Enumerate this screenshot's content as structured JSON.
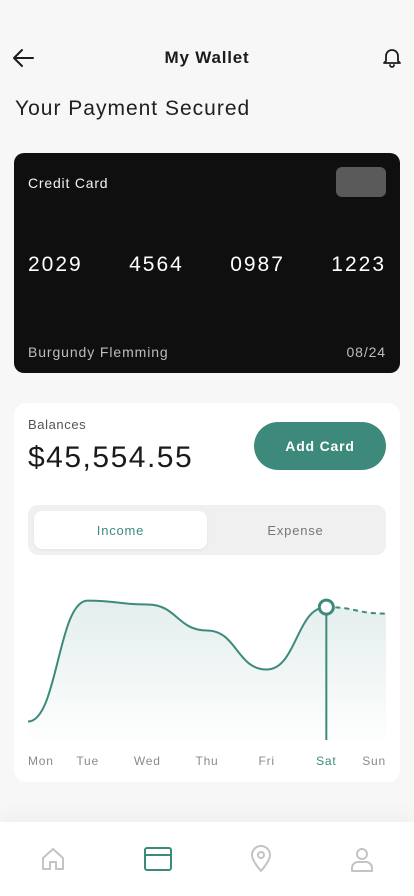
{
  "header": {
    "title": "My Wallet",
    "back_icon": "arrow-left-icon",
    "notification_icon": "bell-icon"
  },
  "page_title": "Your Payment Secured",
  "card": {
    "label": "Credit Card",
    "number_groups": [
      "2029",
      "4564",
      "0987",
      "1223"
    ],
    "holder": "Burgundy Flemming",
    "expiry": "08/24",
    "background_color": "#0f0f0f"
  },
  "balance": {
    "label": "Balances",
    "value": "$45,554.55",
    "add_card_label": "Add Card"
  },
  "tabs": {
    "income_label": "Income",
    "expense_label": "Expense",
    "selected": "Income"
  },
  "chart_data": {
    "type": "area",
    "categories": [
      "Mon",
      "Tue",
      "Wed",
      "Thu",
      "Fri",
      "Sat",
      "Sun"
    ],
    "highlighted_category": "Sat",
    "accent_color": "#3d8a7c",
    "series": [
      {
        "values": [
          0.05,
          0.98,
          0.95,
          0.75,
          0.45,
          0.93,
          0.88
        ]
      }
    ]
  },
  "bottom_nav": {
    "items": [
      {
        "icon": "home-icon",
        "active": false
      },
      {
        "icon": "card-icon",
        "active": true
      },
      {
        "icon": "location-pin-icon",
        "active": false
      },
      {
        "icon": "profile-icon",
        "active": false
      }
    ],
    "active_color": "#3d8a7c",
    "inactive_color": "#c4c4c4"
  }
}
